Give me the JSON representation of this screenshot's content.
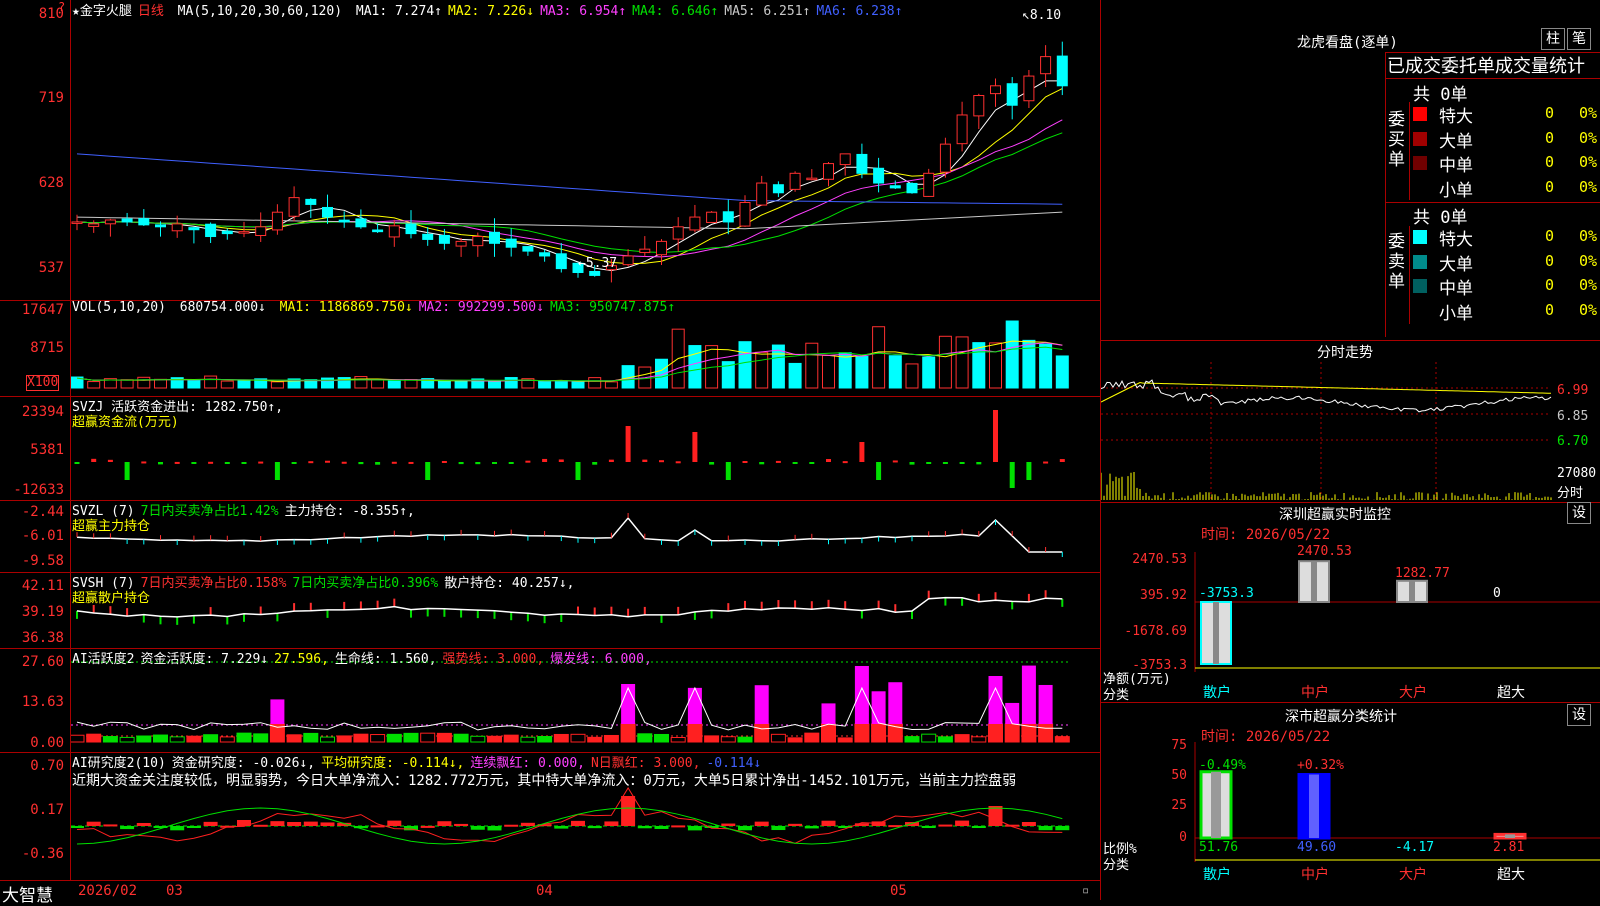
{
  "kline": {
    "star_title": "★金字火腿",
    "period": "日线",
    "ma_header": "MA(5,10,20,30,60,120)",
    "ma": [
      {
        "text": "MA1: 7.274↑",
        "color": "#ffffff"
      },
      {
        "text": "MA2: 7.226↓",
        "color": "#ffff00"
      },
      {
        "text": "MA3: 6.954↑",
        "color": "#ff40ff"
      },
      {
        "text": "MA4: 6.646↑",
        "color": "#00e000"
      },
      {
        "text": "MA5: 6.251↑",
        "color": "#c8c8c8"
      },
      {
        "text": "MA6: 6.238↑",
        "color": "#4060ff"
      }
    ],
    "y_ticks": [
      "810",
      "719",
      "628",
      "537"
    ],
    "high_marker": "8.10",
    "low_marker": "5.37"
  },
  "volume": {
    "title": "VOL(5,10,20)",
    "value": "680754.000↓",
    "ma": [
      {
        "text": "MA1: 1186869.750↓",
        "color": "#ffff00"
      },
      {
        "text": "MA2: 992299.500↓",
        "color": "#ff40ff"
      },
      {
        "text": "MA3: 950747.875↑",
        "color": "#00e000"
      }
    ],
    "y_ticks": [
      "17647",
      "8715"
    ],
    "unit": "X100"
  },
  "svzj": {
    "line1": "SVZJ  活跃资金进出: 1282.750↑,",
    "line2": "超赢资金流(万元)",
    "y_ticks": [
      "23394",
      "5381",
      "-12633"
    ]
  },
  "svzl": {
    "prefix": "SVZL (7)",
    "part1": "7日内买卖净占比1.42%",
    "part2": "主力持仓: -8.355↑,",
    "line2": "超赢主力持仓",
    "y_ticks": [
      "-2.44",
      "-6.01",
      "-9.58"
    ]
  },
  "svsh": {
    "prefix": "SVSH (7)",
    "part1": "7日内买卖净占比0.158%",
    "part2": "7日内买卖净占比0.396%",
    "part3": "散户持仓: 40.257↓,",
    "line2": "超赢散户持仓",
    "y_ticks": [
      "42.11",
      "39.19",
      "36.38"
    ]
  },
  "ai_active": {
    "prefix": "AI活跃度2",
    "p1": "资金活跃度: 7.229↓",
    "p2": "27.596,",
    "p3": "生命线: 1.560,",
    "p4": "强势线: 3.000,",
    "p5": "爆发线: 6.000,",
    "y_ticks": [
      "27.60",
      "13.63",
      "0.00"
    ]
  },
  "ai_research": {
    "prefix": "AI研究度2(10)",
    "p1": "资金研究度: -0.026↓,",
    "p2": "平均研究度: -0.114↓,",
    "p3": "连续飘红: 0.000,",
    "p4": "N日飘红: 3.000,",
    "p5": "-0.114↓",
    "comment": "近期大资金关注度较低，明显弱势，今日大单净流入：1282.772万元，其中特大单净流入：0万元，大单5日累计净出-1452.101万元，当前主力控盘弱",
    "y_ticks": [
      "0.70",
      "0.17",
      "-0.36"
    ]
  },
  "bottom_bar": {
    "brand": "大智慧",
    "dates": [
      "2026/02",
      "03",
      "04",
      "05"
    ]
  },
  "right": {
    "lhb_title": "龙虎看盘(逐单)",
    "btn_zhu": "柱",
    "btn_bi": "笔",
    "header": "已成交委托单成交量统计",
    "buy_label": "委买单",
    "buy_total": "共 0单",
    "sell_label": "委卖单",
    "sell_total": "共 0单",
    "rows": [
      {
        "label": "特大",
        "color": "#ff0000",
        "v1": "0",
        "v2": "0%"
      },
      {
        "label": "大单",
        "color": "#a00000",
        "v1": "0",
        "v2": "0%"
      },
      {
        "label": "中单",
        "color": "#700000",
        "v1": "0",
        "v2": "0%"
      },
      {
        "label": "小单",
        "color": "#000000",
        "v1": "0",
        "v2": "0%"
      }
    ],
    "sell_rows": [
      {
        "label": "特大",
        "color": "#00ffff",
        "v1": "0",
        "v2": "0%"
      },
      {
        "label": "大单",
        "color": "#008c8c",
        "v1": "0",
        "v2": "0%"
      },
      {
        "label": "中单",
        "color": "#006060",
        "v1": "0",
        "v2": "0%"
      },
      {
        "label": "小单",
        "color": "#000000",
        "v1": "0",
        "v2": "0%"
      }
    ],
    "fenshi_title": "分时走势",
    "fenshi_ticks": [
      "6.99",
      "6.85",
      "6.70"
    ],
    "fenshi_vol": "27080",
    "fenshi_vol_label": "分时",
    "monitor_title": "深圳超赢实时监控",
    "monitor_set": "设",
    "monitor_time": "时间: 2026/05/22",
    "monitor_ticks": [
      "2470.53",
      "395.92",
      "-1678.69",
      "-3753.3"
    ],
    "monitor_ylabel": "净额(万元)",
    "monitor_xlabel": "分类",
    "monitor_cats": [
      "散户",
      "中户",
      "大户",
      "超大"
    ],
    "monitor_values": [
      "-3753.3",
      "2470.53",
      "1282.77",
      "0"
    ],
    "stat_title": "深市超赢分类统计",
    "stat_set": "设",
    "stat_time": "时间: 2026/05/22",
    "stat_ticks": [
      "75",
      "50",
      "25",
      "0"
    ],
    "stat_ylabel": "比例%",
    "stat_xlabel": "分类",
    "stat_top": [
      "-0.49%",
      "+0.32%"
    ],
    "stat_bottom": [
      "51.76",
      "49.60",
      "-4.17",
      "2.81"
    ],
    "stat_cats": [
      "散户",
      "中户",
      "大户",
      "超大"
    ]
  }
}
